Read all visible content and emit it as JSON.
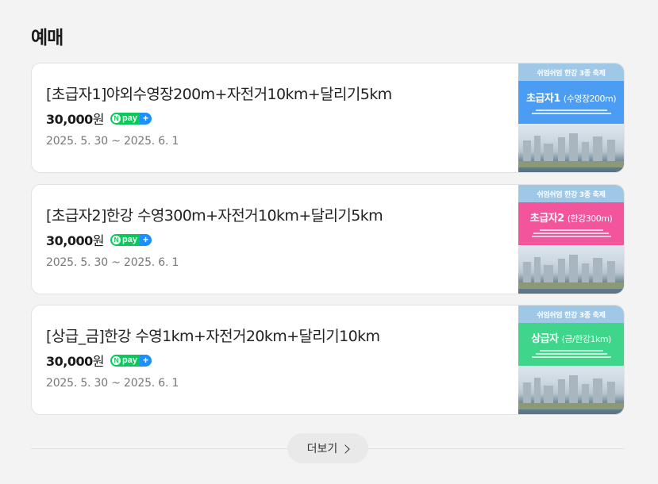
{
  "section": {
    "title": "예매"
  },
  "items": [
    {
      "title": "[초급자1]야외수영장200m+자전거10km+달리기5km",
      "price": "30,000",
      "currency": "원",
      "pay_badge": {
        "n": "N",
        "label": "pay",
        "plus": "+"
      },
      "dates": "2025. 5. 30 ~ 2025. 6. 1",
      "thumb": {
        "header": "쉬엄쉬엄 한강 3종 축제",
        "level": "초급자1",
        "sub": "(수영장200m)",
        "color": "#4a9df2"
      }
    },
    {
      "title": "[초급자2]한강 수영300m+자전거10km+달리기5km",
      "price": "30,000",
      "currency": "원",
      "pay_badge": {
        "n": "N",
        "label": "pay",
        "plus": "+"
      },
      "dates": "2025. 5. 30 ~ 2025. 6. 1",
      "thumb": {
        "header": "쉬엄쉬엄 한강 3종 축제",
        "level": "초급자2",
        "sub": "(한강300m)",
        "color": "#f2559b"
      }
    },
    {
      "title": "[상급_금]한강 수영1km+자전거20km+달리기10km",
      "price": "30,000",
      "currency": "원",
      "pay_badge": {
        "n": "N",
        "label": "pay",
        "plus": "+"
      },
      "dates": "2025. 5. 30 ~ 2025. 6. 1",
      "thumb": {
        "header": "쉬엄쉬엄 한강 3종 축제",
        "level": "상급자",
        "sub": "(금/한강1km)",
        "color": "#3fd58a"
      }
    }
  ],
  "more": {
    "label": "더보기"
  }
}
